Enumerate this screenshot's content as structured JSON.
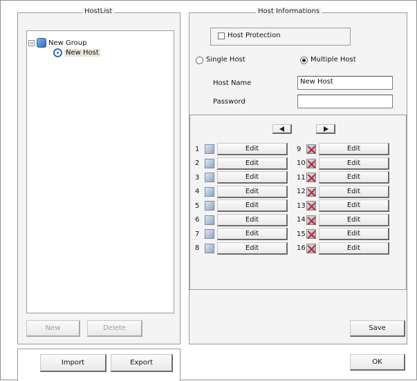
{
  "hostlist": {
    "title": "HostList",
    "tree": {
      "group_label": "New Group",
      "group_expander": "−",
      "host_label": "New Host"
    },
    "new_label": "New",
    "delete_label": "Delete"
  },
  "host_info": {
    "title": "Host Informations",
    "protection_label": "Host Protection",
    "protection_checked": false,
    "single_host_label": "Single Host",
    "multiple_host_label": "Multiple Host",
    "selected_mode": "Multiple Host",
    "host_name_label": "Host Name",
    "host_name_value": "New Host",
    "password_label": "Password",
    "password_value": "",
    "slots": [
      {
        "num": "1",
        "edit": "Edit",
        "disabled": false
      },
      {
        "num": "2",
        "edit": "Edit",
        "disabled": false
      },
      {
        "num": "3",
        "edit": "Edit",
        "disabled": false
      },
      {
        "num": "4",
        "edit": "Edit",
        "disabled": false
      },
      {
        "num": "5",
        "edit": "Edit",
        "disabled": false
      },
      {
        "num": "6",
        "edit": "Edit",
        "disabled": false
      },
      {
        "num": "7",
        "edit": "Edit",
        "disabled": false
      },
      {
        "num": "8",
        "edit": "Edit",
        "disabled": false
      },
      {
        "num": "9",
        "edit": "Edit",
        "disabled": true
      },
      {
        "num": "10",
        "edit": "Edit",
        "disabled": true
      },
      {
        "num": "11",
        "edit": "Edit",
        "disabled": true
      },
      {
        "num": "12",
        "edit": "Edit",
        "disabled": true
      },
      {
        "num": "13",
        "edit": "Edit",
        "disabled": true
      },
      {
        "num": "14",
        "edit": "Edit",
        "disabled": true
      },
      {
        "num": "15",
        "edit": "Edit",
        "disabled": true
      },
      {
        "num": "16",
        "edit": "Edit",
        "disabled": true
      }
    ],
    "save_label": "Save"
  },
  "footer": {
    "import_label": "Import",
    "export_label": "Export",
    "ok_label": "OK"
  }
}
